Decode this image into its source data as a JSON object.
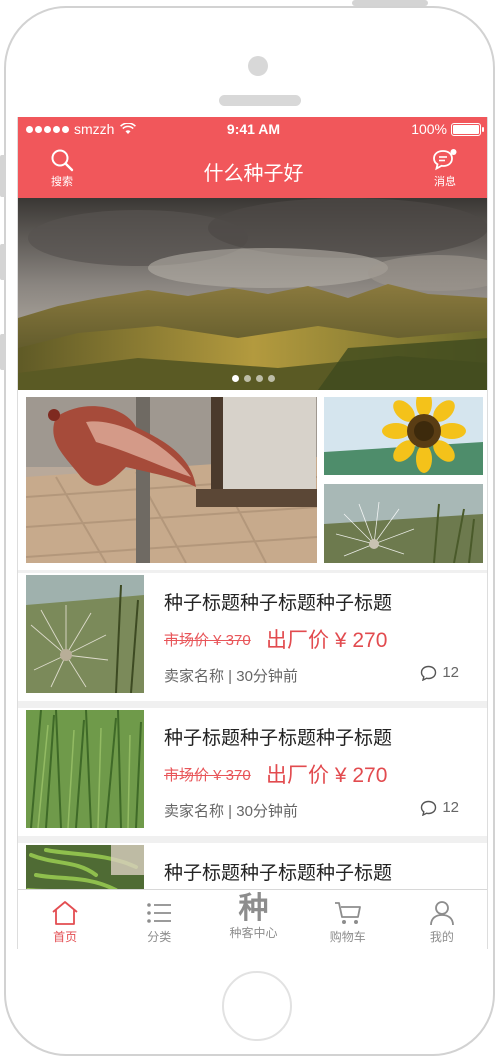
{
  "status_bar": {
    "carrier": "smzzh",
    "time": "9:41 AM",
    "battery": "100%",
    "battery_level": 1.0
  },
  "header": {
    "title": "什么种子好",
    "search_label": "搜索",
    "message_label": "消息",
    "accent_color": "#f1575b"
  },
  "banner": {
    "dot_count": 4,
    "active_index": 0
  },
  "products": [
    {
      "title": "种子标题种子标题种子标题",
      "market_price": "市场价 ¥ 370",
      "factory_price": "出厂价 ¥ 270",
      "meta": "卖家名称 | 30分钟前",
      "comments": "12"
    },
    {
      "title": "种子标题种子标题种子标题",
      "market_price": "市场价 ¥ 370",
      "factory_price": "出厂价 ¥ 270",
      "meta": "卖家名称 | 30分钟前",
      "comments": "12"
    },
    {
      "title": "种子标题种子标题种子标题"
    }
  ],
  "tabbar": {
    "items": [
      {
        "label": "首页",
        "icon": "home-icon",
        "active": true
      },
      {
        "label": "分类",
        "icon": "list-icon",
        "active": false
      },
      {
        "label": "种客中心",
        "icon_char": "种",
        "active": false
      },
      {
        "label": "购物车",
        "icon": "cart-icon",
        "active": false
      },
      {
        "label": "我的",
        "icon": "user-icon",
        "active": false
      }
    ]
  }
}
